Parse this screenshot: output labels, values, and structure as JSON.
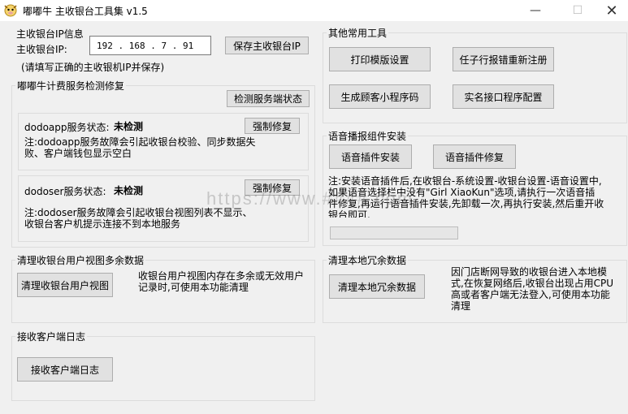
{
  "window": {
    "title": "嘟嘟牛 主收银台工具集 v1.5",
    "minimize": "—",
    "maximize": "☐",
    "close": "✕"
  },
  "ip_section": {
    "title": "主收银台IP信息",
    "ip_label": "主收银台IP:",
    "ip_value": "192  . 168  .  7   .  91",
    "save_button": "保存主收银台IP",
    "hint": "(请填写正确的主收银机IP并保存)"
  },
  "service_section": {
    "title": "嘟嘟牛计费服务检测修复",
    "check_button": "检测服务端状态",
    "dodoapp": {
      "label": "dodoapp服务状态:",
      "status": "未检测",
      "fix_button": "强制修复",
      "note": "注:dodoapp服务故障会引起收银台校验、同步数据失败、客户端钱包显示空白"
    },
    "dodoser": {
      "label": "dodoser服务状态:",
      "status": "未检测",
      "fix_button": "强制修复",
      "note": "注:dodoser服务故障会引起收银台视图列表不显示、收银台客户机提示连接不到本地服务"
    }
  },
  "clear_view_section": {
    "title": "清理收银台用户视图多余数据",
    "button": "清理收银台用户视图",
    "note": "收银台用户视图内存在多余或无效用户记录时,可使用本功能清理"
  },
  "log_section": {
    "title": "接收客户端日志",
    "button": "接收客户端日志"
  },
  "other_tools": {
    "title": "其他常用工具",
    "buttons": [
      "打印模版设置",
      "任子行报错重新注册",
      "生成顾客小程序码",
      "实名接口程序配置"
    ]
  },
  "voice_section": {
    "title": "语音播报组件安装",
    "install_button": "语音插件安装",
    "repair_button": "语音插件修复",
    "note": "注:安装语音插件后,在收银台-系统设置-收银台设置-语音设置中,如果语音选择栏中没有\"Girl XiaoKun\"选项,请执行一次语音插件修复,再运行语音插件安装,先卸载一次,再执行安装,然后重开收银台即可.",
    "progress": 0
  },
  "clear_local_section": {
    "title": "清理本地冗余数据",
    "button": "清理本地冗余数据",
    "note": "因门店断网导致的收银台进入本地模式,在恢复网络后,收银台出现占用CPU高或者客户端无法登入,可使用本功能清理"
  },
  "watermark": "https://www.####.com"
}
